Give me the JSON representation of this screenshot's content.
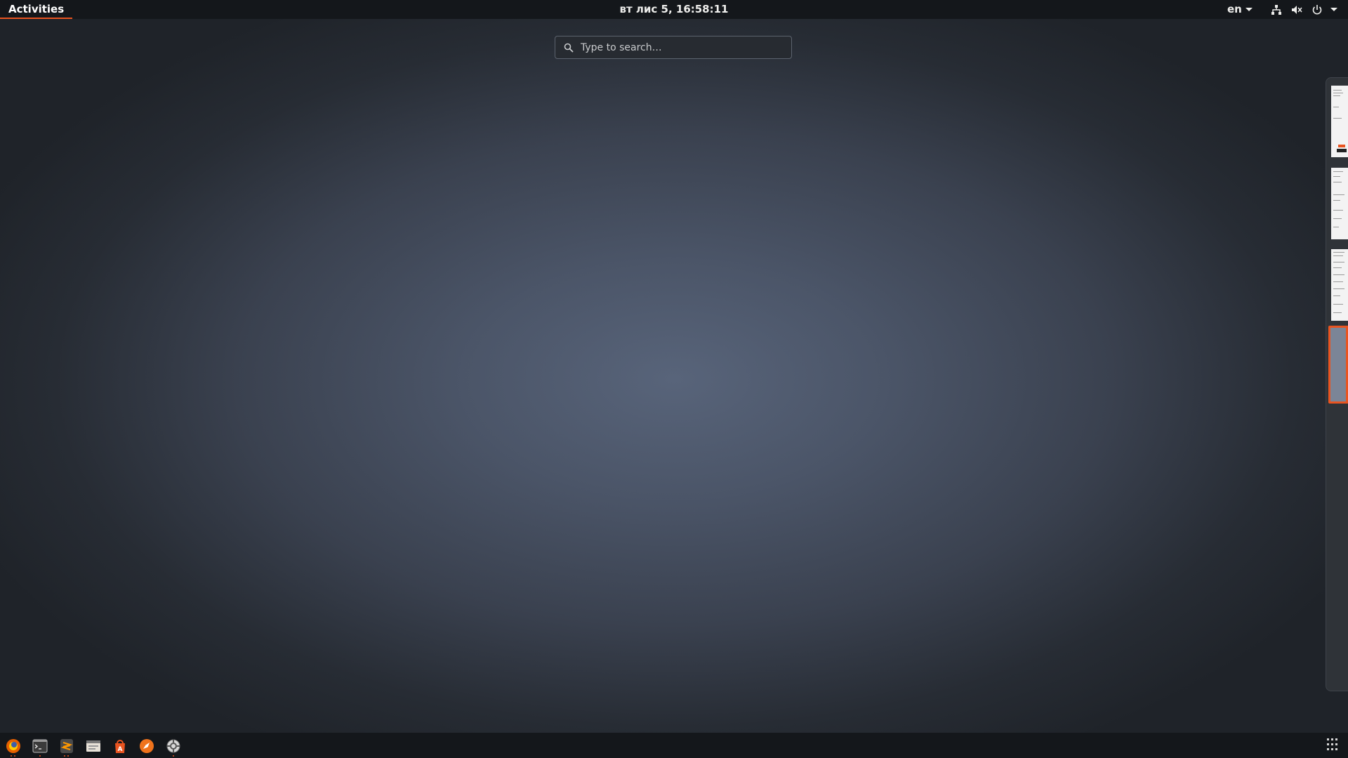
{
  "topbar": {
    "activities": "Activities",
    "clock": "вт лис  5, 16:58:11",
    "language": "en"
  },
  "search": {
    "placeholder": "Type to search…"
  },
  "colors": {
    "accent": "#e95420",
    "panel": "#14171b"
  },
  "tray": {
    "icons": [
      "network-icon",
      "volume-muted-icon",
      "power-icon",
      "chevron-down-icon"
    ]
  },
  "workspaces": {
    "count": 4,
    "active_index": 4
  },
  "dock": {
    "apps": [
      "firefox-icon",
      "terminal-icon",
      "sublime-text-icon",
      "files-icon",
      "software-center-icon",
      "compass-icon",
      "system-settings-icon"
    ]
  }
}
